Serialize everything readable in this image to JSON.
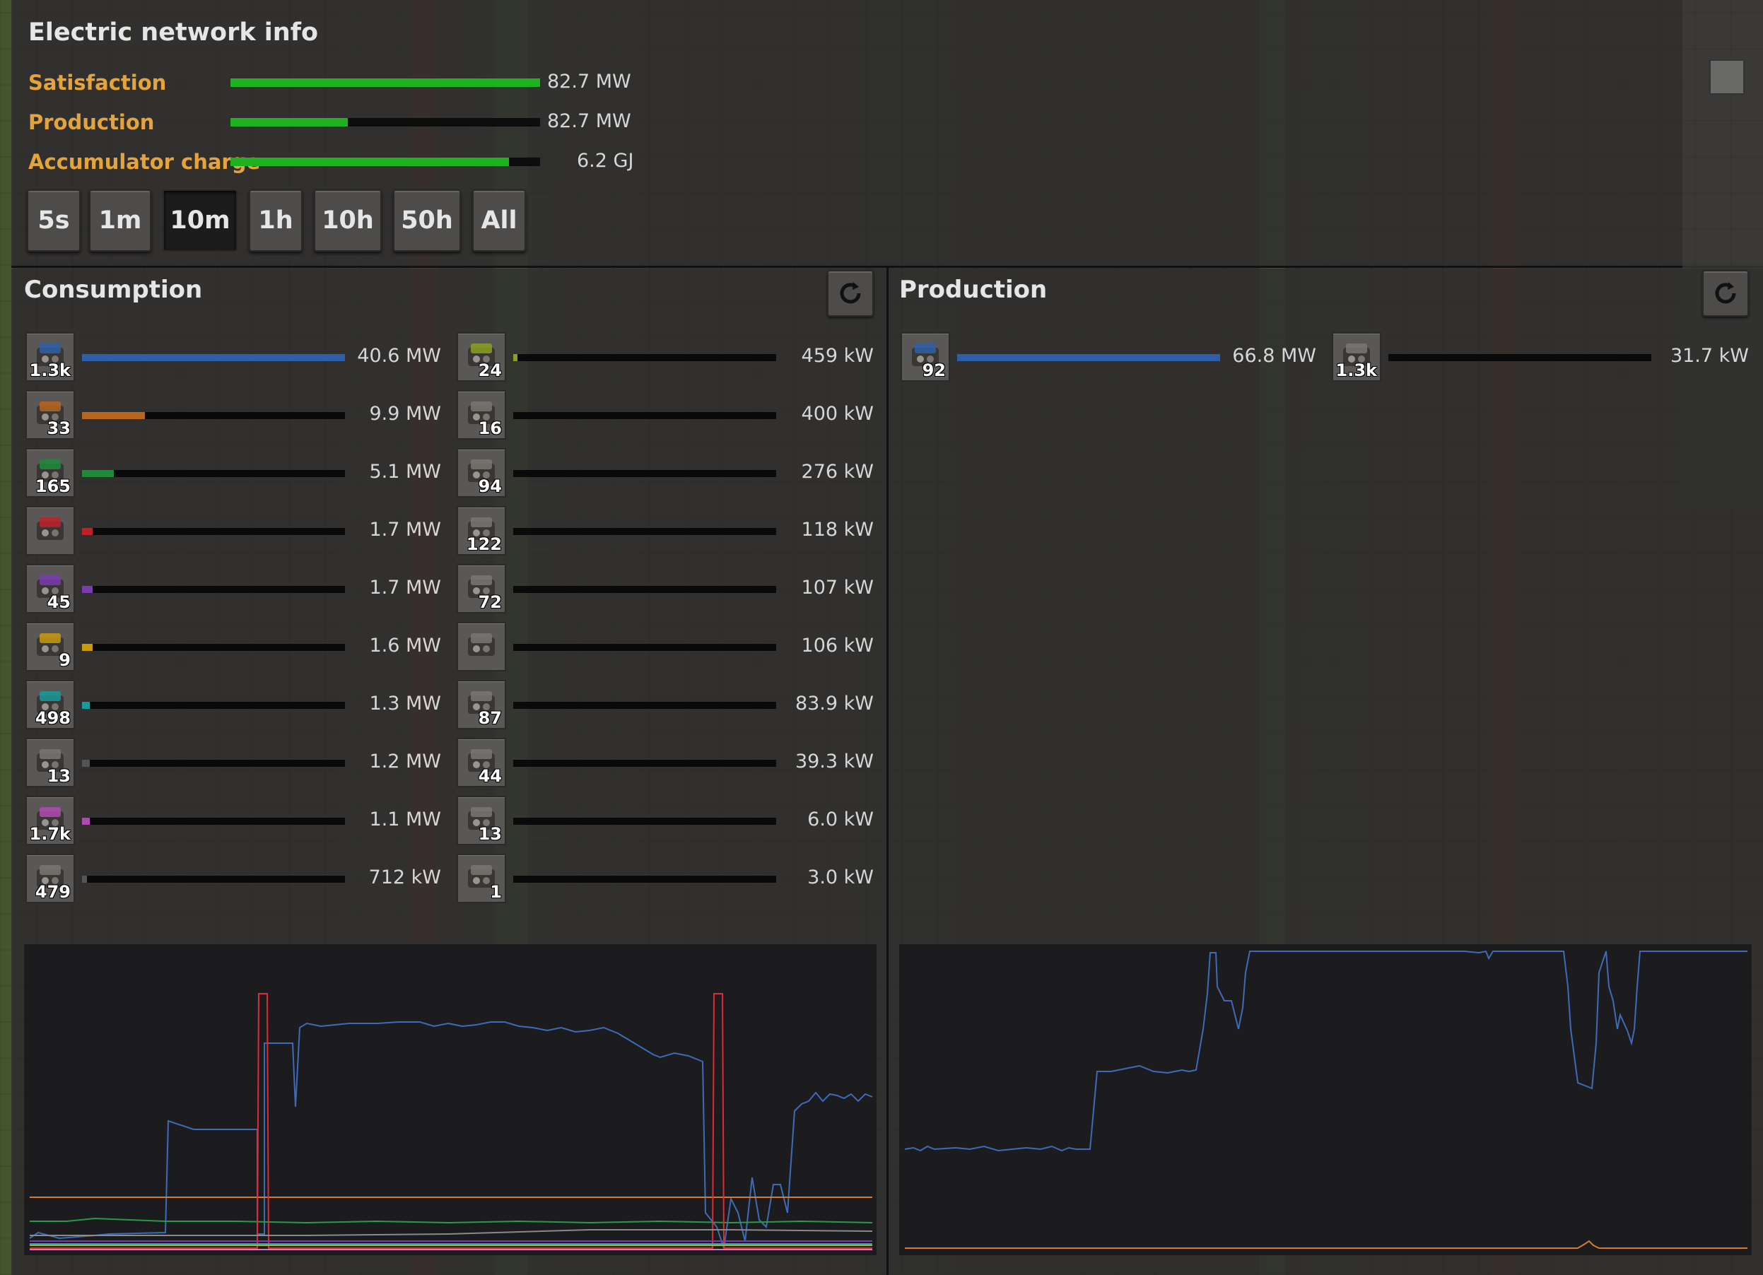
{
  "window": {
    "title": "Electric network info"
  },
  "stats": [
    {
      "label": "Satisfaction",
      "value": "82.7 MW",
      "fill": 1.0
    },
    {
      "label": "Production",
      "value": "82.7 MW",
      "fill": 0.38
    },
    {
      "label": "Accumulator charge",
      "value": "6.2 GJ",
      "fill": 0.9
    }
  ],
  "time_buttons": [
    {
      "label": "5s",
      "selected": false
    },
    {
      "label": "1m",
      "selected": false
    },
    {
      "label": "10m",
      "selected": true
    },
    {
      "label": "1h",
      "selected": false
    },
    {
      "label": "10h",
      "selected": false
    },
    {
      "label": "50h",
      "selected": false
    },
    {
      "label": "All",
      "selected": false
    }
  ],
  "consumption": {
    "title": "Consumption",
    "col1": [
      {
        "icon": "roboport-icon",
        "count": "1.3k",
        "value": "40.6 MW",
        "fill": 1.0,
        "color": "#2f5fa8"
      },
      {
        "icon": "mining-drill-icon",
        "count": "33",
        "value": "9.9 MW",
        "fill": 0.24,
        "color": "#b8651e"
      },
      {
        "icon": "inserter-icon",
        "count": "165",
        "value": "5.1 MW",
        "fill": 0.12,
        "color": "#1f8a3a"
      },
      {
        "icon": "lamp-icon",
        "count": "",
        "value": "1.7 MW",
        "fill": 0.04,
        "color": "#c0202a"
      },
      {
        "icon": "assembler-icon",
        "count": "45",
        "value": "1.7 MW",
        "fill": 0.04,
        "color": "#7a3bb0"
      },
      {
        "icon": "pumpjack-icon",
        "count": "9",
        "value": "1.6 MW",
        "fill": 0.04,
        "color": "#c89a10"
      },
      {
        "icon": "fast-inserter-icon",
        "count": "498",
        "value": "1.3 MW",
        "fill": 0.03,
        "color": "#1a9a9a"
      },
      {
        "icon": "gear-assembler-icon",
        "count": "13",
        "value": "1.2 MW",
        "fill": 0.03,
        "color": "#555555"
      },
      {
        "icon": "long-inserter-icon",
        "count": "1.7k",
        "value": "1.1 MW",
        "fill": 0.03,
        "color": "#b04ab0"
      },
      {
        "icon": "stack-inserter-icon",
        "count": "479",
        "value": "712 kW",
        "fill": 0.02,
        "color": "#555555"
      }
    ],
    "col2": [
      {
        "icon": "radar-icon",
        "count": "24",
        "value": "459 kW",
        "fill": 0.015,
        "color": "#8aa020"
      },
      {
        "icon": "oil-refinery-icon",
        "count": "16",
        "value": "400 kW",
        "fill": 0.0,
        "color": "#555555"
      },
      {
        "icon": "filter-inserter-icon",
        "count": "94",
        "value": "276 kW",
        "fill": 0.0,
        "color": "#555555"
      },
      {
        "icon": "chemical-plant-icon",
        "count": "122",
        "value": "118 kW",
        "fill": 0.0,
        "color": "#555555"
      },
      {
        "icon": "lab-icon",
        "count": "72",
        "value": "107 kW",
        "fill": 0.0,
        "color": "#555555"
      },
      {
        "icon": "pump-icon",
        "count": "",
        "value": "106 kW",
        "fill": 0.0,
        "color": "#555555"
      },
      {
        "icon": "beacon-icon",
        "count": "87",
        "value": "83.9 kW",
        "fill": 0.0,
        "color": "#555555"
      },
      {
        "icon": "electric-furnace-icon",
        "count": "44",
        "value": "39.3 kW",
        "fill": 0.0,
        "color": "#555555"
      },
      {
        "icon": "burner-inserter-icon",
        "count": "13",
        "value": "6.0 kW",
        "fill": 0.0,
        "color": "#555555"
      },
      {
        "icon": "combinator-icon",
        "count": "1",
        "value": "3.0 kW",
        "fill": 0.0,
        "color": "#555555"
      }
    ]
  },
  "production": {
    "title": "Production",
    "items": [
      {
        "icon": "steam-engine-icon",
        "count": "92",
        "value": "66.8 MW",
        "fill": 1.0,
        "color": "#2f5fa8"
      },
      {
        "icon": "roboport-icon",
        "count": "1.3k",
        "value": "31.7 kW",
        "fill": 0.0,
        "color": "#555555"
      }
    ]
  }
}
